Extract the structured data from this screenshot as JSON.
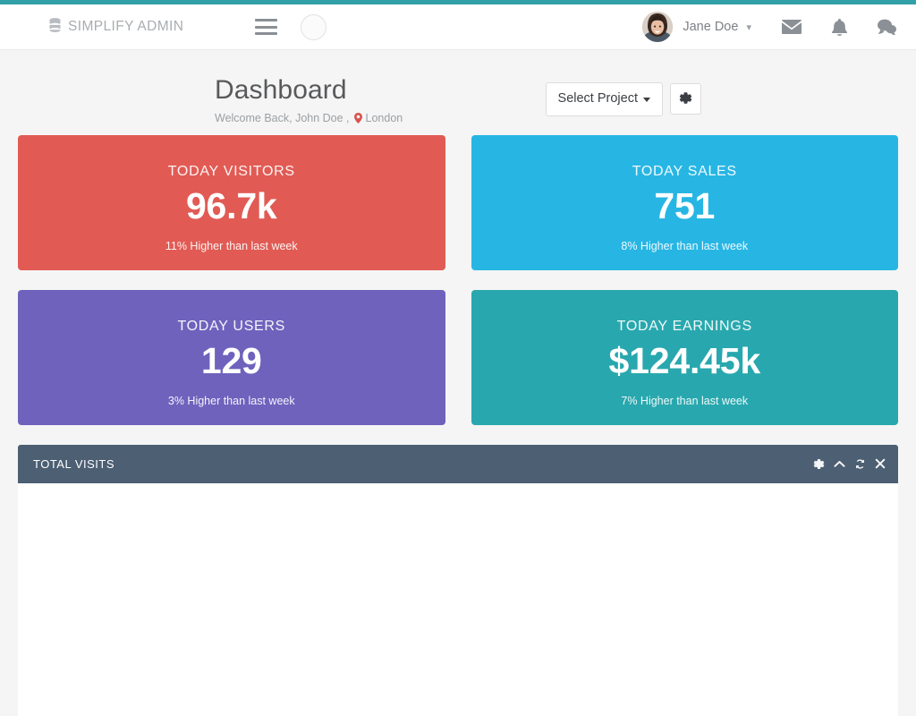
{
  "theme": {
    "accent_bar": "#32a0a8",
    "panel_header": "#4c5f73",
    "page_background": "#f5f5f5"
  },
  "topbar": {
    "brand": "SIMPLIFY ADMIN",
    "brand_icon": "database-icon",
    "menu_icon": "hamburger-menu-icon",
    "circle_button_icon": "circle-toggle-icon",
    "user_name": "Jane Doe",
    "user_caret": "⌄",
    "avatar_icon": "user-avatar-photo",
    "icons": [
      {
        "name": "messages-icon",
        "glyph": "envelope"
      },
      {
        "name": "notifications-icon",
        "glyph": "bell"
      },
      {
        "name": "chat-icon",
        "glyph": "comment"
      }
    ]
  },
  "page": {
    "title": "Dashboard",
    "welcome_text": "Welcome Back, John Doe ,",
    "location": "London",
    "location_icon": "map-pin-icon",
    "select_project_label": "Select Project",
    "settings_icon": "gear-icon"
  },
  "stat_cards": [
    {
      "label": "TODAY VISITORS",
      "value": "96.7k",
      "footnote": "11% Higher than last week",
      "color": "#e15b54"
    },
    {
      "label": "TODAY SALES",
      "value": "751",
      "footnote": "8% Higher than last week",
      "color": "#27b6e4"
    },
    {
      "label": "TODAY USERS",
      "value": "129",
      "footnote": "3% Higher than last week",
      "color": "#6f62bd"
    },
    {
      "label": "TODAY EARNINGS",
      "value": "$124.45k",
      "footnote": "7% Higher than last week",
      "color": "#28a8ae"
    }
  ],
  "panel": {
    "title": "TOTAL VISITS",
    "tools": [
      {
        "name": "panel-config-icon",
        "glyph": "gear"
      },
      {
        "name": "panel-collapse-icon",
        "glyph": "chevron-up"
      },
      {
        "name": "panel-refresh-icon",
        "glyph": "refresh"
      },
      {
        "name": "panel-close-icon",
        "glyph": "close"
      }
    ]
  }
}
